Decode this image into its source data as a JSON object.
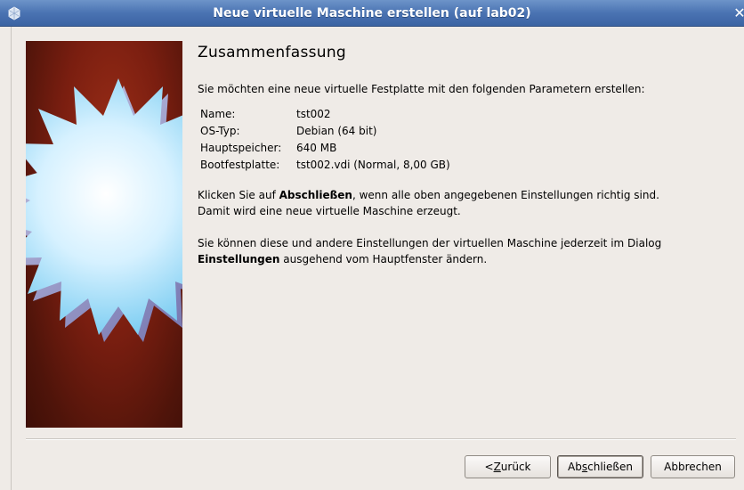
{
  "window": {
    "title": "Neue virtuelle Maschine erstellen (auf lab02)",
    "close_glyph": "✕"
  },
  "page": {
    "heading": "Zusammenfassung",
    "intro": "Sie möchten eine neue virtuelle Festplatte mit den folgenden Parametern erstellen:",
    "params": [
      {
        "key": "Name:",
        "value": "tst002"
      },
      {
        "key": "OS-Typ:",
        "value": "Debian (64 bit)"
      },
      {
        "key": "Hauptspeicher:",
        "value": "640 MB"
      },
      {
        "key": "Bootfestplatte:",
        "value": "tst002.vdi (Normal, 8,00 GB)"
      }
    ],
    "click_pre": "Klicken Sie auf ",
    "click_bold": "Abschließen",
    "click_post": ", wenn alle oben angegebenen Einstellungen richtig sind.",
    "click_line2": "Damit wird eine neue virtuelle Maschine erzeugt.",
    "settings_line1": "Sie können diese und andere Einstellungen der virtuellen Maschine jederzeit im Dialog",
    "settings_bold": "Einstellungen",
    "settings_post": " ausgehend vom Hauptfenster ändern."
  },
  "buttons": {
    "back_pre": "< ",
    "back_mnemonic": "Z",
    "back_post": "urück",
    "finish_pre": "Ab",
    "finish_mnemonic": "s",
    "finish_post": "chließen",
    "cancel": "Abbrechen"
  },
  "colors": {
    "titlebar": "#4a73b2",
    "dialog_bg": "#efebe7",
    "image_bg": "#7a1e10",
    "star": "#bfe6fb"
  },
  "icons": {
    "app": "virtualbox-icon",
    "close": "close-icon",
    "wizard": "starburst-icon"
  }
}
